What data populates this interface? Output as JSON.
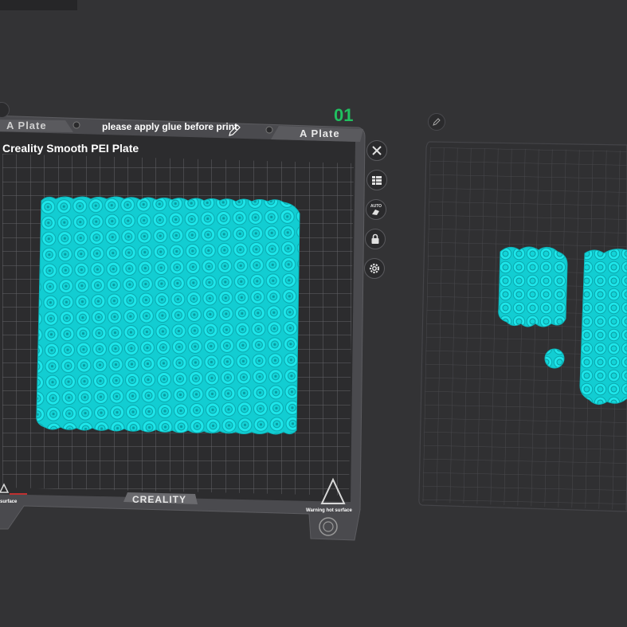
{
  "plate1": {
    "number": "01",
    "left_tab_label": "A Plate",
    "right_tab_label": "A Plate",
    "notice": "please apply glue before print",
    "plate_type": "Creality Smooth PEI Plate",
    "brand": "CREALITY",
    "warning_text": "Warning hot surface",
    "warning_text_left": "surface"
  },
  "toolbar": {
    "close": "close-icon",
    "arrange": "arrange-list-icon",
    "auto_label": "AUTO",
    "auto": "auto-orient-icon",
    "lock": "lock-icon",
    "settings": "gear-icon"
  },
  "colors": {
    "background": "#333335",
    "plate": "#2b2b2d",
    "grid": "#5e5e62",
    "model": "#15dde0",
    "plate_number": "#20c060"
  }
}
